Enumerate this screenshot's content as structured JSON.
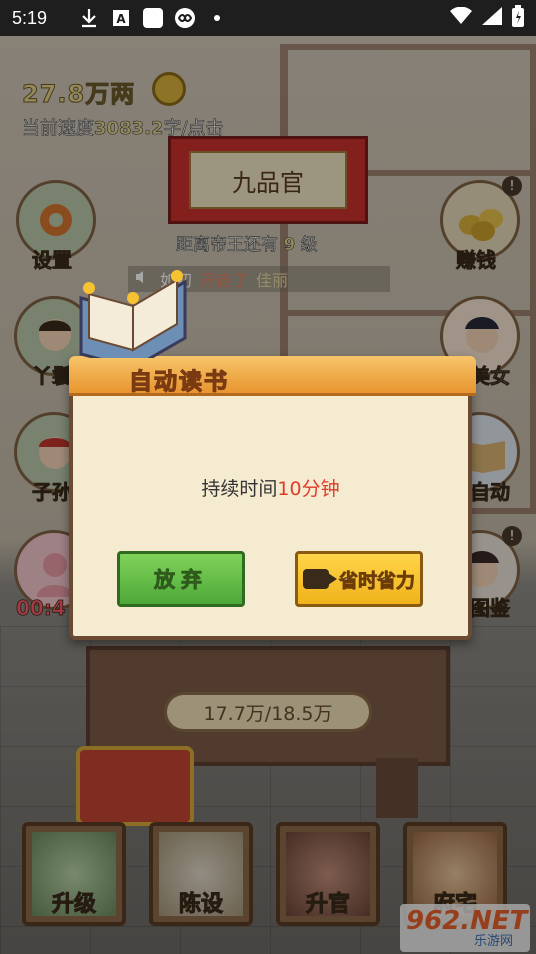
{
  "status_bar": {
    "time": "5:19",
    "icons": [
      "download-icon",
      "a-box-icon",
      "white-square-icon",
      "infinity-icon",
      "dot-icon"
    ],
    "right_icons": [
      "wifi-icon",
      "signal-icon",
      "battery-icon"
    ]
  },
  "hud": {
    "money": "27.8万两",
    "speed_prefix": "当前速度",
    "speed_value": "3083.2",
    "speed_suffix": "字/点击",
    "rank_title": "九品官",
    "distance_prefix": "距离帝王还有",
    "distance_num": "9",
    "distance_suffix": "级"
  },
  "notice": {
    "part1": "如初",
    "part2": "开启了",
    "part3": "佳丽"
  },
  "side_buttons": {
    "settings": "设置",
    "earn": "赚钱",
    "maid": "丫鬟",
    "consort": "美女",
    "children": "子孙",
    "auto": "自动",
    "timer": "00:4",
    "guide": "图鉴"
  },
  "desk": {
    "progress": "17.7万/18.5万"
  },
  "bottom_bar": {
    "upgrade": "升级",
    "decor": "陈设",
    "promote": "升官",
    "residence": "府宅"
  },
  "modal": {
    "title": "自动读书",
    "duration_label": "持续时间",
    "duration_value": "10分钟",
    "give_up_label": "放弃",
    "save_time_label": "省时省力"
  },
  "watermark": {
    "brand": "962.NET",
    "sub": "乐游网"
  },
  "colors": {
    "accent_red": "#e23a2a",
    "green_button": "#4ea838",
    "yellow_button": "#f0b21a",
    "title_orange": "#e8952f"
  }
}
